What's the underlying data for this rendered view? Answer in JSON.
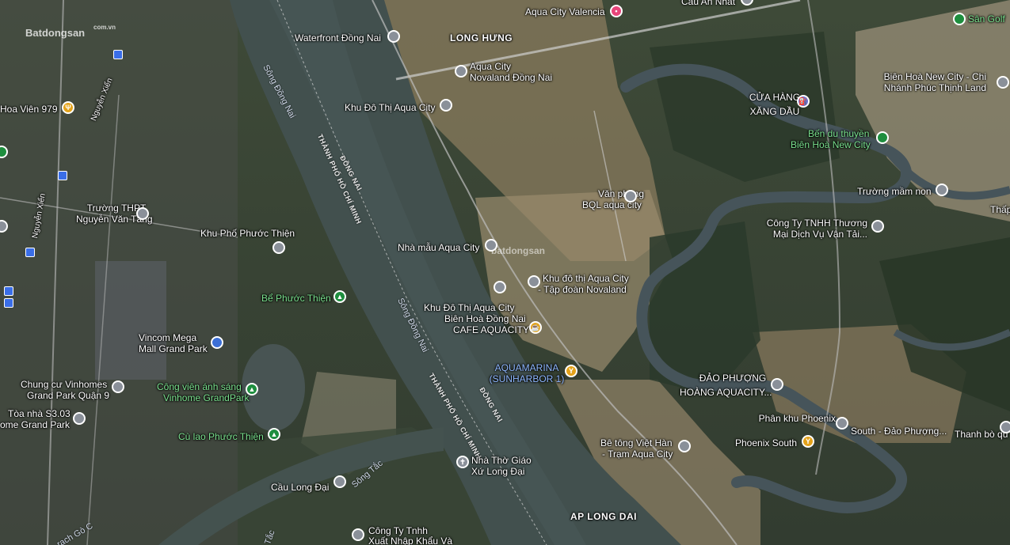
{
  "watermark": {
    "main": "Batdongsan",
    "sub": "com.vn",
    "center": "batdongsan"
  },
  "area_labels": {
    "long_hung": "LONG HƯNG",
    "ap_long_dai": "AP LONG DAI"
  },
  "rivers": {
    "song_dong_nai_1": "Sông Đồng Nai",
    "song_dong_nai_2": "Sông Đồng Nai",
    "song_tac_1": "Sông Tắc",
    "song_tac_2": "Tắc",
    "rach": "rạch Gò C"
  },
  "provinces": {
    "dong_nai_1": "ĐỒNG NAI",
    "hcm_1": "THÀNH PHỐ HỒ CHÍ MINH",
    "dong_nai_2": "ĐỒNG NAI",
    "hcm_2": "THÀNH PHỐ HỒ CHÍ MINH"
  },
  "streets": {
    "nguyen_xien_1": "Nguyễn Xiển",
    "nguyen_xien_2": "Nguyễn Xiển"
  },
  "places": {
    "aqua_valencia": "Aqua City Valencia",
    "cau_an_nhat": "Cầu An Nhất",
    "waterfront": "Waterfront Đồng Nai",
    "aqua_novaland_1": "Aqua City",
    "aqua_novaland_2": "Novaland Đồng Nai",
    "khu_do_thi": "Khu Đô Thị Aqua City",
    "cua_hang_1": "CỬA HÀNG",
    "cua_hang_2": "XĂNG DẦU",
    "bien_hoa_1": "Biên Hoà New City - Chi",
    "bien_hoa_2": "Nhánh Phúc Thịnh Land",
    "ben_du_1": "Bến du thuyền",
    "ben_du_2": "Biên Hoà New City",
    "san_golf": "Sân Golf",
    "hoa_vien": "Hoa Viên 979",
    "van_phong_1": "Văn phòng",
    "van_phong_2": "BQL aqua city",
    "truong_mam_non": "Trường mầm non",
    "truong_thpt_1": "Trường THPT",
    "truong_thpt_2": "Nguyễn Văn Tăng",
    "cong_ty_tm_1": "Công Ty TNHH Thương",
    "cong_ty_tm_2": "Mại Dịch Vụ Vận Tải...",
    "khu_pho": "Khu Phố Phước Thiện",
    "nha_mau": "Nhà mẫu Aqua City",
    "khu_novaland_1": "Khu đô thị Aqua City",
    "khu_novaland_2": "- Tập đoàn Novaland",
    "be_phuoc": "Bể Phước Thiện",
    "khu_bien_hoa_1": "Khu Đô Thị Aqua City",
    "khu_bien_hoa_2": "Biên Hoà Đồng Nai",
    "cafe": "CAFE AQUACITY",
    "vincom_1": "Vincom Mega",
    "vincom_2": "Mall Grand Park",
    "aquamarina_1": "AQUAMARINA",
    "aquamarina_2": "(SUNHARBOR 1)",
    "dao_phuong_1": "ĐẢO PHƯỢNG",
    "dao_phuong_2": "HOÀNG AQUACITY...",
    "chung_cu_1": "Chung cư Vinhomes",
    "chung_cu_2": "Grand Park Quận 9",
    "cong_vien_1": "Công viên ánh sáng",
    "cong_vien_2": "Vinhome GrandPark",
    "phan_khu_1": "Phân khu Phoenix",
    "phan_khu_2": "South - Đảo Phượng...",
    "toa_nha_1": "Tòa nhà S3.03",
    "toa_nha_2": "ome Grand Park",
    "thanh_bo": "Thanh bò qu",
    "cu_lao": "Cù lao Phước Thiện",
    "be_tong_1": "Bê tông Việt Hàn",
    "be_tong_2": "- Trạm Aqua City",
    "phoenix": "Phoenix South",
    "nha_tho_1": "Nhà Thờ Giáo",
    "nha_tho_2": "Xứ Long Đại",
    "cau_long_dai": "Cầu Long Đại",
    "cong_ty_xnk_1": "Công Ty Tnhh",
    "cong_ty_xnk_2": "Xuất Nhập Khẩu Và",
    "thap": "Thấp"
  }
}
